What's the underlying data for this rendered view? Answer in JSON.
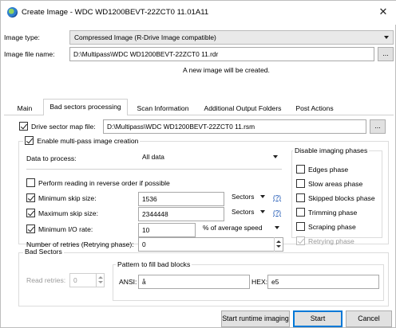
{
  "window": {
    "title": "Create Image - WDC WD1200BEVT-22ZCT0 11.01A11",
    "close_glyph": "✕"
  },
  "image_type": {
    "label": "Image type:",
    "value": "Compressed Image (R-Drive Image compatible)"
  },
  "image_file": {
    "label": "Image file name:",
    "value": "D:\\Multipass\\WDC WD1200BEVT-22ZCT0 11.rdr",
    "browse_label": "...",
    "note": "A new image will be created."
  },
  "tabs": [
    {
      "label": "Main"
    },
    {
      "label": "Bad sectors processing"
    },
    {
      "label": "Scan Information"
    },
    {
      "label": "Additional Output Folders"
    },
    {
      "label": "Post Actions"
    }
  ],
  "drive_map": {
    "label": "Drive sector map file:",
    "value": "D:\\Multipass\\WDC WD1200BEVT-22ZCT0 11.rsm",
    "browse_label": "...",
    "checked": true
  },
  "multipass": {
    "label": "Enable multi-pass image creation",
    "checked": true
  },
  "data_to_process": {
    "label": "Data to process:",
    "value": "All data"
  },
  "reverse_order": {
    "label": "Perform reading in reverse order if possible",
    "checked": false
  },
  "min_skip": {
    "label": "Minimum skip size:",
    "value": "1536",
    "unit": "Sectors",
    "help": "(?)",
    "checked": true
  },
  "max_skip": {
    "label": "Maximum skip size:",
    "value": "2344448",
    "unit": "Sectors",
    "help": "(?)",
    "checked": true
  },
  "min_io": {
    "label": "Minimum I/O rate:",
    "value": "10",
    "unit": "% of average speed",
    "checked": true
  },
  "retries": {
    "label": "Number of retries (Retrying phase):",
    "value": "0"
  },
  "disable_phases": {
    "title": "Disable imaging phases",
    "items": [
      {
        "label": "Edges phase",
        "checked": false,
        "disabled": false
      },
      {
        "label": "Slow areas phase",
        "checked": false,
        "disabled": false
      },
      {
        "label": "Skipped blocks phase",
        "checked": false,
        "disabled": false
      },
      {
        "label": "Trimming phase",
        "checked": false,
        "disabled": false
      },
      {
        "label": "Scraping phase",
        "checked": false,
        "disabled": false
      },
      {
        "label": "Retrying phase",
        "checked": true,
        "disabled": true
      }
    ]
  },
  "bad_sectors": {
    "title": "Bad Sectors",
    "read_retries_label": "Read retries:",
    "read_retries_value": "0",
    "pattern_title": "Pattern to fill bad blocks",
    "ansi_label": "ANSI:",
    "ansi_value": "å",
    "hex_label": "HEX:",
    "hex_value": "e5"
  },
  "buttons": {
    "runtime": "Start runtime imaging",
    "start": "Start",
    "cancel": "Cancel"
  }
}
